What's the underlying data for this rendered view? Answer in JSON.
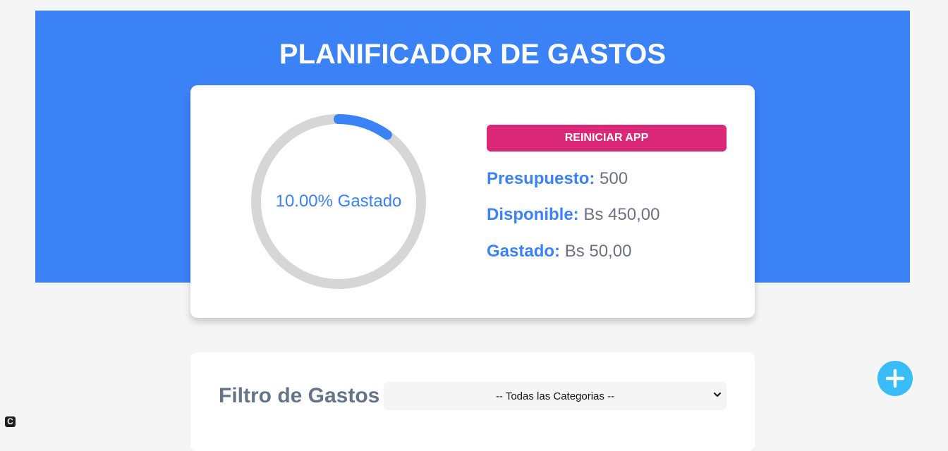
{
  "header": {
    "title": "PLANIFICADOR DE GASTOS"
  },
  "budget": {
    "progress_percent": 10,
    "progress_label": "10.00% Gastado",
    "reset_label": "REINICIAR APP",
    "presupuesto_label": "Presupuesto:",
    "presupuesto_value": "500",
    "disponible_label": "Disponible:",
    "disponible_value": "Bs 450,00",
    "gastado_label": "Gastado:",
    "gastado_value": "Bs 50,00"
  },
  "filter": {
    "label": "Filtro de Gastos",
    "selected": "-- Todas las Categorias --"
  },
  "colors": {
    "header_bg": "#3b82f6",
    "accent": "#3b82f6",
    "reset": "#db2777",
    "add": "#38bdf8",
    "track": "#d6d6d6"
  },
  "icons": {
    "add": "plus-icon",
    "select": "chevron-down-icon",
    "corner": "c-icon"
  },
  "corner_icon_glyph": "C"
}
